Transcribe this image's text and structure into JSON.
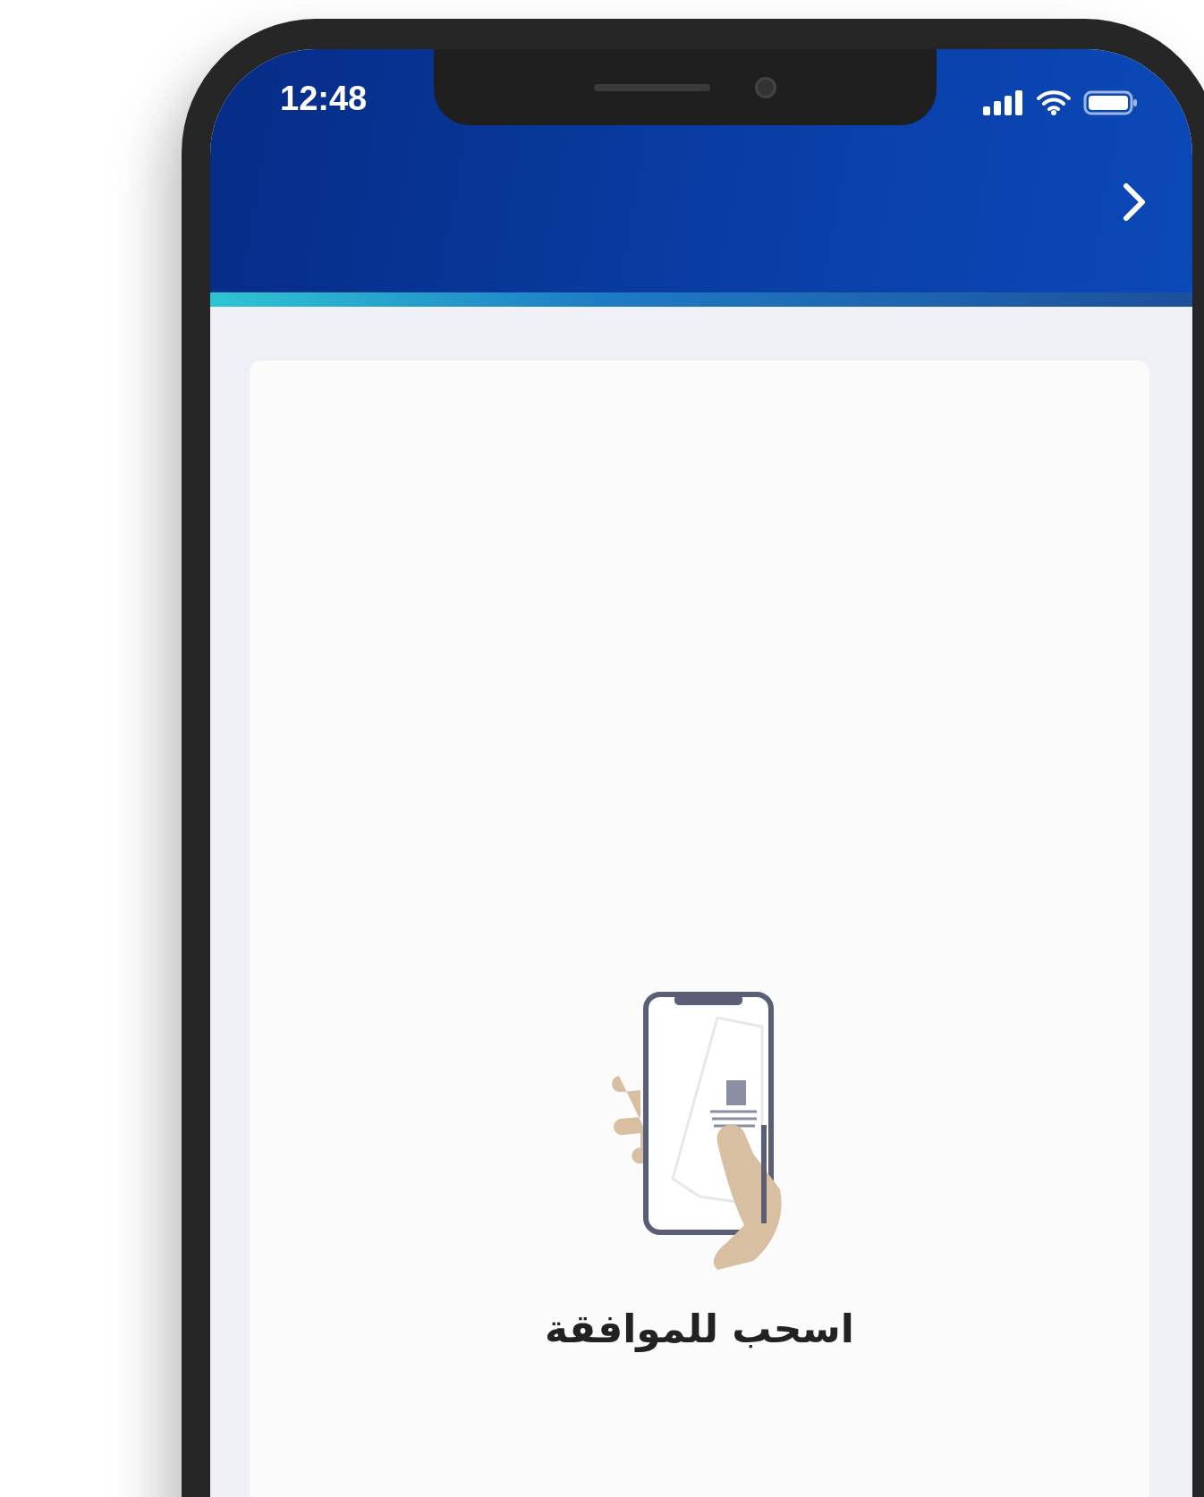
{
  "status_bar": {
    "time": "12:48"
  },
  "card": {
    "caption": "اسحب للموافقة"
  }
}
